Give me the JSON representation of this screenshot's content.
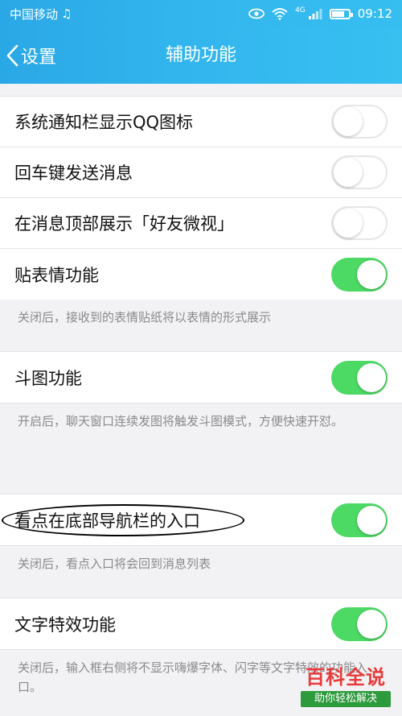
{
  "status_bar": {
    "carrier": "中国移动",
    "network": "4G",
    "time": "09:12",
    "battery_level": 0.75
  },
  "nav": {
    "back_label": "设置",
    "title": "辅助功能"
  },
  "settings": {
    "system_notify_qq_icon": {
      "label": "系统通知栏显示QQ图标",
      "enabled": false
    },
    "enter_to_send": {
      "label": "回车键发送消息",
      "enabled": false
    },
    "friend_video_top": {
      "label": "在消息顶部展示「好友微视」",
      "enabled": false
    },
    "sticker": {
      "label": "贴表情功能",
      "enabled": true,
      "note": "关闭后，接收到的表情贴纸将以表情的形式展示"
    },
    "doutu": {
      "label": "斗图功能",
      "enabled": true,
      "note": "开启后，聊天窗口连续发图将触发斗图模式，方便快速开怼。"
    },
    "kandian": {
      "label": "看点在底部导航栏的入口",
      "enabled": true,
      "note": "关闭后，看点入口将会回到消息列表"
    },
    "text_effects": {
      "label": "文字特效功能",
      "enabled": true,
      "note": "关闭后，输入框右侧将不显示嗨爆字体、闪字等文字特效的功能入口。"
    }
  },
  "watermark": {
    "title": "百科全说",
    "subtitle": "助你轻松解决"
  },
  "colors": {
    "header": "#33b6ee",
    "toggle_on": "#4cd964",
    "note_text": "#8a8a8e",
    "watermark_red": "#e83a3a",
    "watermark_green": "#2d9a3c"
  }
}
